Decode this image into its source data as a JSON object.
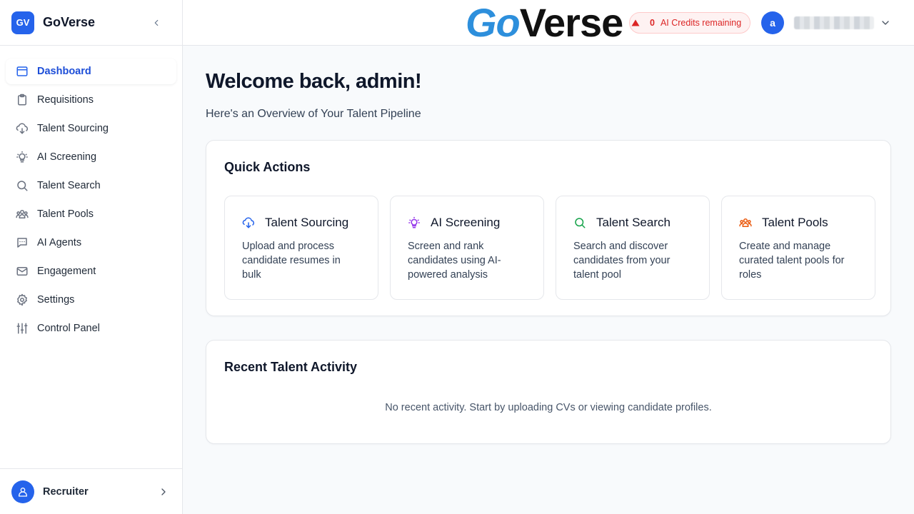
{
  "sidebar": {
    "logo_initials": "GV",
    "app_name": "GoVerse",
    "items": [
      {
        "label": "Dashboard",
        "icon": "dashboard-icon"
      },
      {
        "label": "Requisitions",
        "icon": "clipboard-icon"
      },
      {
        "label": "Talent Sourcing",
        "icon": "cloud-download-icon"
      },
      {
        "label": "AI Screening",
        "icon": "lightbulb-icon"
      },
      {
        "label": "Talent Search",
        "icon": "search-icon"
      },
      {
        "label": "Talent Pools",
        "icon": "users-icon"
      },
      {
        "label": "AI Agents",
        "icon": "chat-icon"
      },
      {
        "label": "Engagement",
        "icon": "mail-icon"
      },
      {
        "label": "Settings",
        "icon": "gear-icon"
      },
      {
        "label": "Control Panel",
        "icon": "sliders-icon"
      }
    ],
    "active": "Dashboard",
    "footer_role": "Recruiter"
  },
  "header": {
    "brand_go": "Go",
    "brand_verse": "Verse",
    "credits_count": "0",
    "credits_label": "AI Credits remaining",
    "user_initial": "a"
  },
  "main": {
    "welcome": "Welcome back, admin!",
    "subtitle": "Here's an Overview of Your Talent Pipeline",
    "quick_actions": {
      "title": "Quick Actions",
      "tiles": [
        {
          "title": "Talent Sourcing",
          "desc": "Upload and process candidate resumes in bulk",
          "icon": "cloud-download-icon",
          "color": "#2563eb"
        },
        {
          "title": "AI Screening",
          "desc": "Screen and rank candidates using AI-powered analysis",
          "icon": "lightbulb-icon",
          "color": "#9333ea"
        },
        {
          "title": "Talent Search",
          "desc": "Search and discover candidates from your talent pool",
          "icon": "search-icon",
          "color": "#16a34a"
        },
        {
          "title": "Talent Pools",
          "desc": "Create and manage curated talent pools for roles",
          "icon": "users-icon",
          "color": "#ea580c"
        }
      ]
    },
    "recent_activity": {
      "title": "Recent Talent Activity",
      "empty": "No recent activity. Start by uploading CVs or viewing candidate profiles."
    }
  },
  "colors": {
    "accent": "#2563eb",
    "brand_go": "#2d8fdc",
    "credits_red": "#dc2626"
  }
}
